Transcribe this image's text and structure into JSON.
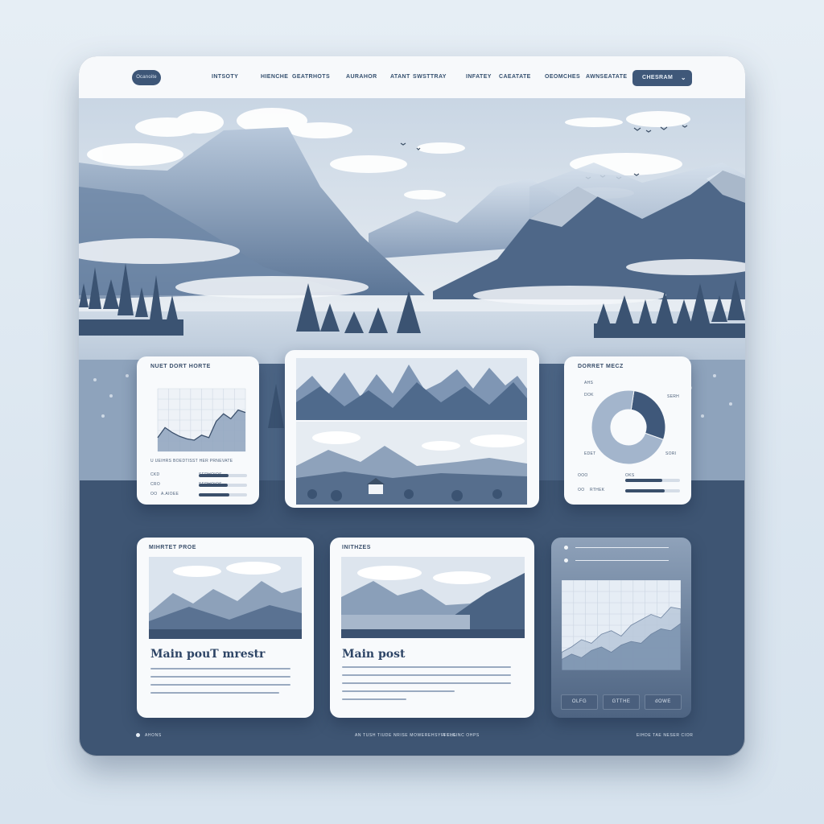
{
  "nav": {
    "logo": "Ocanoite",
    "items": [
      "INTSOTY",
      "HIENCHE",
      "GEATRHOTS",
      "AURAHOR",
      "ATANT",
      "SWSTTRAY",
      "INFATEY",
      "CAEATATE",
      "OEOMCHES",
      "AWNSEATATE"
    ],
    "cta_label": "CHESRAM",
    "cta_icon": "chevron-down-icon"
  },
  "widgets": {
    "left_chart": {
      "title": "NUET DORT HORTE",
      "caption": "U UEIHRS BOEDTISST HER PRNEVATE",
      "y_ticks": [
        "",
        "",
        "",
        "",
        "",
        "",
        ""
      ],
      "rows": [
        {
          "code": "CKD",
          "label": "SERHOIOS",
          "fill": 0.62
        },
        {
          "code": "CRO",
          "label": "SERHOIOS",
          "fill": 0.6
        },
        {
          "code": "OO",
          "label": "A.AIOEE",
          "fill": 0.64
        }
      ]
    },
    "donut": {
      "title": "DORRET MECZ",
      "labels": {
        "left_top": "AHS",
        "left_mid": "DOK",
        "right_mid": "SERH",
        "bottom_left": "EDET",
        "bottom_right": "SORI"
      },
      "rows": [
        {
          "code": "OOO",
          "label": "OKS",
          "fill": 0.68
        },
        {
          "code": "OO",
          "label": "RTHEK",
          "fill": 0.72
        }
      ],
      "segments": [
        0.28,
        0.72
      ]
    },
    "posts": [
      {
        "kicker": "MIHRTET PROE",
        "title": "Main pouT mrestr"
      },
      {
        "kicker": "INITHZES",
        "title": "Main post"
      }
    ],
    "stats": {
      "buttons": [
        "OLFG",
        "GTTHE",
        "dOWE"
      ]
    }
  },
  "footer": {
    "left": "AHONS",
    "center_a": "AN TUSH TIUDE NRISE MOWEREHSYFFELG",
    "center_b": "A FHLINC OHPS",
    "right": "EIHDE TAE NESER CIOR"
  },
  "chart_data": [
    {
      "type": "area",
      "title": "NUET DORT HORTE",
      "xlabel": "",
      "ylabel": "",
      "x": [
        0,
        1,
        2,
        3,
        4,
        5,
        6,
        7,
        8,
        9,
        10,
        11,
        12
      ],
      "values": [
        22,
        38,
        30,
        24,
        20,
        18,
        26,
        22,
        48,
        60,
        52,
        66,
        62
      ],
      "ylim": [
        0,
        100
      ],
      "grid": true
    },
    {
      "type": "pie",
      "title": "DORRET MECZ",
      "categories": [
        "",
        ""
      ],
      "values": [
        28,
        72
      ]
    },
    {
      "type": "area",
      "title": "",
      "xlabel": "",
      "ylabel": "",
      "series": [
        {
          "values": [
            20,
            26,
            34,
            30,
            40,
            44,
            38,
            50,
            56,
            62,
            58,
            70,
            68
          ]
        },
        {
          "values": [
            12,
            18,
            14,
            22,
            26,
            20,
            28,
            32,
            30,
            40,
            46,
            44,
            52
          ]
        }
      ],
      "x": [
        0,
        1,
        2,
        3,
        4,
        5,
        6,
        7,
        8,
        9,
        10,
        11,
        12
      ],
      "ylim": [
        0,
        100
      ],
      "grid": true
    }
  ]
}
